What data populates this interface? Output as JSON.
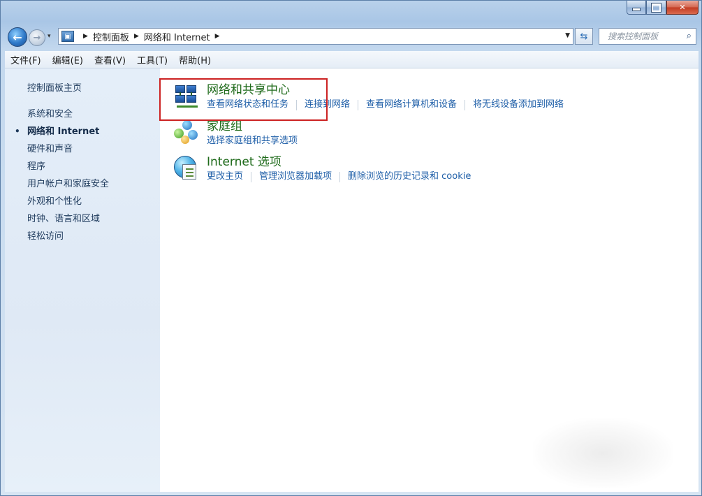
{
  "window": {
    "caption_buttons": {
      "minimize": "min-icon",
      "maximize": "max-icon",
      "close": "✕"
    }
  },
  "address_bar": {
    "breadcrumbs": [
      "控制面板",
      "网络和 Internet"
    ]
  },
  "search": {
    "placeholder": "搜索控制面板"
  },
  "menu": {
    "items": [
      "文件(F)",
      "编辑(E)",
      "查看(V)",
      "工具(T)",
      "帮助(H)"
    ]
  },
  "nav": {
    "home": "控制面板主页",
    "items": [
      "系统和安全",
      "网络和 Internet",
      "硬件和声音",
      "程序",
      "用户帐户和家庭安全",
      "外观和个性化",
      "时钟、语言和区域",
      "轻松访问"
    ],
    "current_index": 1
  },
  "categories": [
    {
      "title": "网络和共享中心",
      "icon": "network-center-icon",
      "links": [
        "查看网络状态和任务",
        "连接到网络",
        "查看网络计算机和设备",
        "将无线设备添加到网络"
      ]
    },
    {
      "title": "家庭组",
      "icon": "homegroup-icon",
      "links": [
        "选择家庭组和共享选项"
      ]
    },
    {
      "title": "Internet 选项",
      "icon": "internet-options-icon",
      "links": [
        "更改主页",
        "管理浏览器加载项",
        "删除浏览的历史记录和 cookie"
      ]
    }
  ],
  "colors": {
    "title_green": "#1e6a1a",
    "link_blue": "#1f5fa8",
    "highlight_red": "#cc2222"
  }
}
